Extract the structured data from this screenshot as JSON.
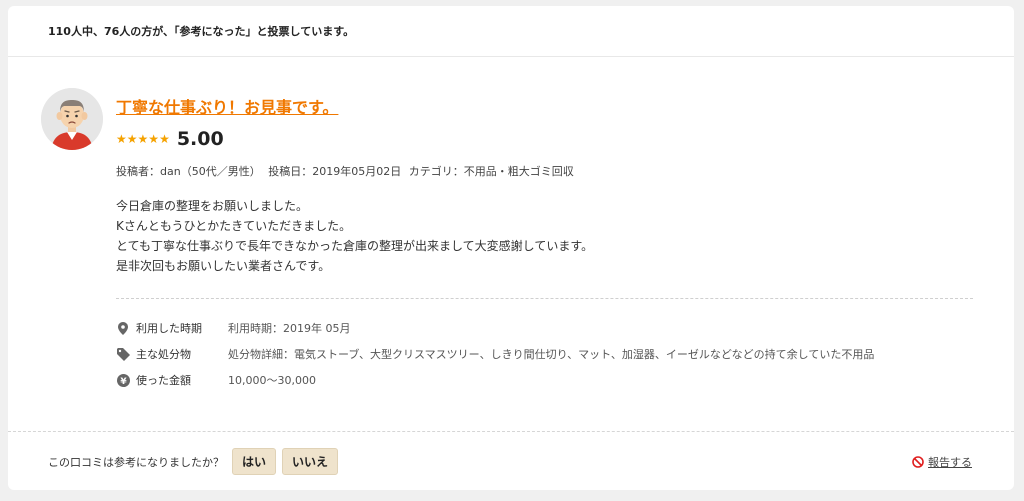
{
  "vote_summary": "110人中、76人の方が、「参考になった」と投票しています。",
  "review": {
    "title": "丁寧な仕事ぶり！お見事です。",
    "score": "5.00",
    "stars": 5,
    "meta": {
      "author": "投稿者：dan（50代／男性）",
      "posted": "投稿日：2019年05月02日",
      "category": "カテゴリ：不用品・粗大ゴミ回収"
    },
    "body_lines": [
      "今日倉庫の整理をお願いしました。",
      "Kさんともうひとかたきていただきました。",
      "とても丁寧な仕事ぶりで長年できなかった倉庫の整理が出来まして大変感謝しています。",
      "是非次回もお願いしたい業者さんです。"
    ],
    "details": [
      {
        "icon": "location-pin-icon",
        "label": "利用した時期",
        "value": "利用時期：2019年 05月"
      },
      {
        "icon": "tag-icon",
        "label": "主な処分物",
        "value": "処分物詳細：電気ストーブ、大型クリスマスツリー、しきり間仕切り、マット、加湿器、イーゼルなどなどの持て余していた不用品"
      },
      {
        "icon": "yen-coin-icon",
        "label": "使った金額",
        "value": "10,000〜30,000"
      }
    ]
  },
  "helpful": {
    "question": "この口コミは参考になりましたか？",
    "yes": "はい",
    "no": "いいえ"
  },
  "report_label": "報告する",
  "colors": {
    "accent": "#f07800",
    "star": "#f5a200",
    "button_bg": "#efe3cc"
  }
}
